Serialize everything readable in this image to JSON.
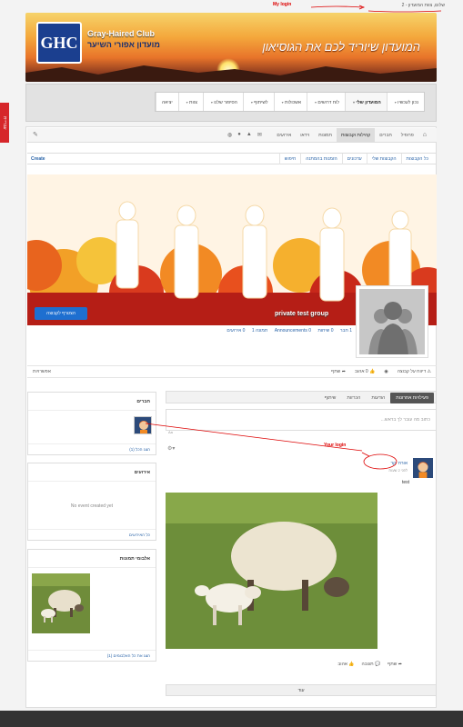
{
  "header": {
    "greeting": "שלום, צוות המועדון - 2",
    "annotation_my_login": "My login"
  },
  "banner": {
    "logo_text": "GHC",
    "club_name_en": "Gray-Haired Club",
    "club_name_he": "מועדון אפורי השיער",
    "slogan": "המועדון שיוריד לכם את הגוסיאון"
  },
  "nav": {
    "items": [
      {
        "label": "נכון לעכשיו",
        "active": false,
        "caret": true
      },
      {
        "label": "המועדון שלי",
        "active": true,
        "caret": true
      },
      {
        "label": "לוח דרושים",
        "active": false,
        "caret": true
      },
      {
        "label": "אשכולות",
        "active": false,
        "caret": true
      },
      {
        "label": "לשיתוף",
        "active": false,
        "caret": true
      },
      {
        "label": "הסיפור שלנו",
        "active": false,
        "caret": true
      },
      {
        "label": "צוות",
        "active": false,
        "caret": true
      },
      {
        "label": "יציאה",
        "active": false,
        "caret": false
      }
    ]
  },
  "side_tab": {
    "label": "עבריית"
  },
  "profile_tabs": {
    "home_icon": "home-icon",
    "tabs": [
      "פרופיל",
      "חברים",
      "קהילות וקבוצות",
      "תמונות",
      "וידאו",
      "אירועים"
    ],
    "active_index": 2
  },
  "group_tabs": {
    "tabs": [
      "כל הקבוצות",
      "הקבוצות שלי",
      "עדכונים",
      "הזמנות בהמתנה",
      "חיפוש"
    ],
    "create_label": "Create"
  },
  "group": {
    "join_button": "הצטרף לקבוצה",
    "name": "private test group",
    "stats": [
      "1 חבר",
      "0 שיחות",
      "0 Announcements",
      "תמונה 1",
      "0 אירועים"
    ]
  },
  "actions": {
    "share": "שתף",
    "like": "0 אהוב",
    "report": "דיווח על קבוצה",
    "admin": "אפשרויות"
  },
  "widgets": {
    "members": {
      "title": "חברים",
      "footer": "הצג הכל (1)"
    },
    "events": {
      "title": "אירועים",
      "empty": "No event created yet",
      "footer": "כל האירועים"
    },
    "albums": {
      "title": "אלבומי תמונות",
      "footer": "הצג את כל האלבומים (1)"
    }
  },
  "feed": {
    "tabs": [
      "פעילויות אחרונות",
      "הודעות",
      "הכרזות",
      "שיתוף"
    ],
    "active_index": 0,
    "composer_placeholder": "כתוב מה עובר לך בראש...",
    "composer_icon": "Aa",
    "post": {
      "author": "אורח יקר",
      "date": "לפני 2 שעות",
      "text": "test",
      "actions": [
        "אהוב",
        "תגובה",
        "שתף"
      ]
    },
    "more_button": "עוד"
  },
  "annotations": {
    "your_login": "Your login"
  }
}
